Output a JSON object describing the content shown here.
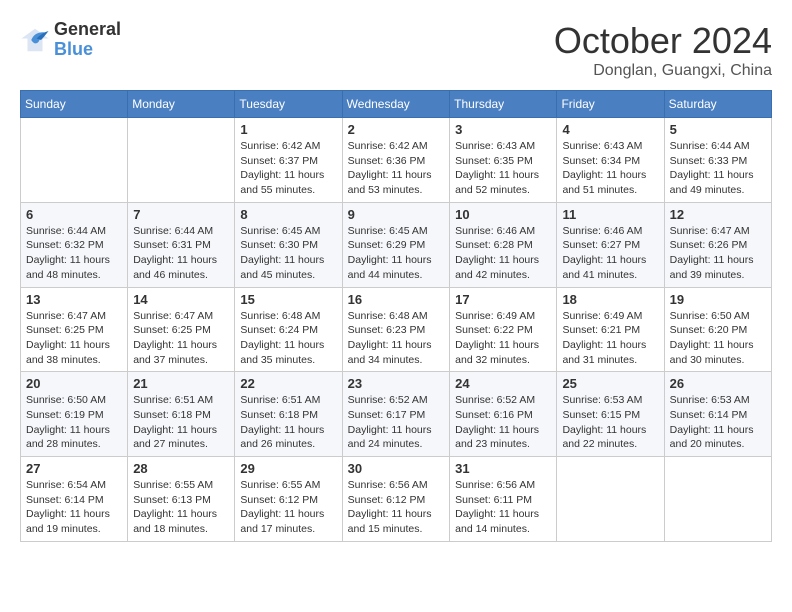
{
  "logo": {
    "text_general": "General",
    "text_blue": "Blue"
  },
  "title": "October 2024",
  "location": "Donglan, Guangxi, China",
  "headers": [
    "Sunday",
    "Monday",
    "Tuesday",
    "Wednesday",
    "Thursday",
    "Friday",
    "Saturday"
  ],
  "weeks": [
    [
      {
        "day": "",
        "info": ""
      },
      {
        "day": "",
        "info": ""
      },
      {
        "day": "1",
        "info": "Sunrise: 6:42 AM\nSunset: 6:37 PM\nDaylight: 11 hours and 55 minutes."
      },
      {
        "day": "2",
        "info": "Sunrise: 6:42 AM\nSunset: 6:36 PM\nDaylight: 11 hours and 53 minutes."
      },
      {
        "day": "3",
        "info": "Sunrise: 6:43 AM\nSunset: 6:35 PM\nDaylight: 11 hours and 52 minutes."
      },
      {
        "day": "4",
        "info": "Sunrise: 6:43 AM\nSunset: 6:34 PM\nDaylight: 11 hours and 51 minutes."
      },
      {
        "day": "5",
        "info": "Sunrise: 6:44 AM\nSunset: 6:33 PM\nDaylight: 11 hours and 49 minutes."
      }
    ],
    [
      {
        "day": "6",
        "info": "Sunrise: 6:44 AM\nSunset: 6:32 PM\nDaylight: 11 hours and 48 minutes."
      },
      {
        "day": "7",
        "info": "Sunrise: 6:44 AM\nSunset: 6:31 PM\nDaylight: 11 hours and 46 minutes."
      },
      {
        "day": "8",
        "info": "Sunrise: 6:45 AM\nSunset: 6:30 PM\nDaylight: 11 hours and 45 minutes."
      },
      {
        "day": "9",
        "info": "Sunrise: 6:45 AM\nSunset: 6:29 PM\nDaylight: 11 hours and 44 minutes."
      },
      {
        "day": "10",
        "info": "Sunrise: 6:46 AM\nSunset: 6:28 PM\nDaylight: 11 hours and 42 minutes."
      },
      {
        "day": "11",
        "info": "Sunrise: 6:46 AM\nSunset: 6:27 PM\nDaylight: 11 hours and 41 minutes."
      },
      {
        "day": "12",
        "info": "Sunrise: 6:47 AM\nSunset: 6:26 PM\nDaylight: 11 hours and 39 minutes."
      }
    ],
    [
      {
        "day": "13",
        "info": "Sunrise: 6:47 AM\nSunset: 6:25 PM\nDaylight: 11 hours and 38 minutes."
      },
      {
        "day": "14",
        "info": "Sunrise: 6:47 AM\nSunset: 6:25 PM\nDaylight: 11 hours and 37 minutes."
      },
      {
        "day": "15",
        "info": "Sunrise: 6:48 AM\nSunset: 6:24 PM\nDaylight: 11 hours and 35 minutes."
      },
      {
        "day": "16",
        "info": "Sunrise: 6:48 AM\nSunset: 6:23 PM\nDaylight: 11 hours and 34 minutes."
      },
      {
        "day": "17",
        "info": "Sunrise: 6:49 AM\nSunset: 6:22 PM\nDaylight: 11 hours and 32 minutes."
      },
      {
        "day": "18",
        "info": "Sunrise: 6:49 AM\nSunset: 6:21 PM\nDaylight: 11 hours and 31 minutes."
      },
      {
        "day": "19",
        "info": "Sunrise: 6:50 AM\nSunset: 6:20 PM\nDaylight: 11 hours and 30 minutes."
      }
    ],
    [
      {
        "day": "20",
        "info": "Sunrise: 6:50 AM\nSunset: 6:19 PM\nDaylight: 11 hours and 28 minutes."
      },
      {
        "day": "21",
        "info": "Sunrise: 6:51 AM\nSunset: 6:18 PM\nDaylight: 11 hours and 27 minutes."
      },
      {
        "day": "22",
        "info": "Sunrise: 6:51 AM\nSunset: 6:18 PM\nDaylight: 11 hours and 26 minutes."
      },
      {
        "day": "23",
        "info": "Sunrise: 6:52 AM\nSunset: 6:17 PM\nDaylight: 11 hours and 24 minutes."
      },
      {
        "day": "24",
        "info": "Sunrise: 6:52 AM\nSunset: 6:16 PM\nDaylight: 11 hours and 23 minutes."
      },
      {
        "day": "25",
        "info": "Sunrise: 6:53 AM\nSunset: 6:15 PM\nDaylight: 11 hours and 22 minutes."
      },
      {
        "day": "26",
        "info": "Sunrise: 6:53 AM\nSunset: 6:14 PM\nDaylight: 11 hours and 20 minutes."
      }
    ],
    [
      {
        "day": "27",
        "info": "Sunrise: 6:54 AM\nSunset: 6:14 PM\nDaylight: 11 hours and 19 minutes."
      },
      {
        "day": "28",
        "info": "Sunrise: 6:55 AM\nSunset: 6:13 PM\nDaylight: 11 hours and 18 minutes."
      },
      {
        "day": "29",
        "info": "Sunrise: 6:55 AM\nSunset: 6:12 PM\nDaylight: 11 hours and 17 minutes."
      },
      {
        "day": "30",
        "info": "Sunrise: 6:56 AM\nSunset: 6:12 PM\nDaylight: 11 hours and 15 minutes."
      },
      {
        "day": "31",
        "info": "Sunrise: 6:56 AM\nSunset: 6:11 PM\nDaylight: 11 hours and 14 minutes."
      },
      {
        "day": "",
        "info": ""
      },
      {
        "day": "",
        "info": ""
      }
    ]
  ]
}
